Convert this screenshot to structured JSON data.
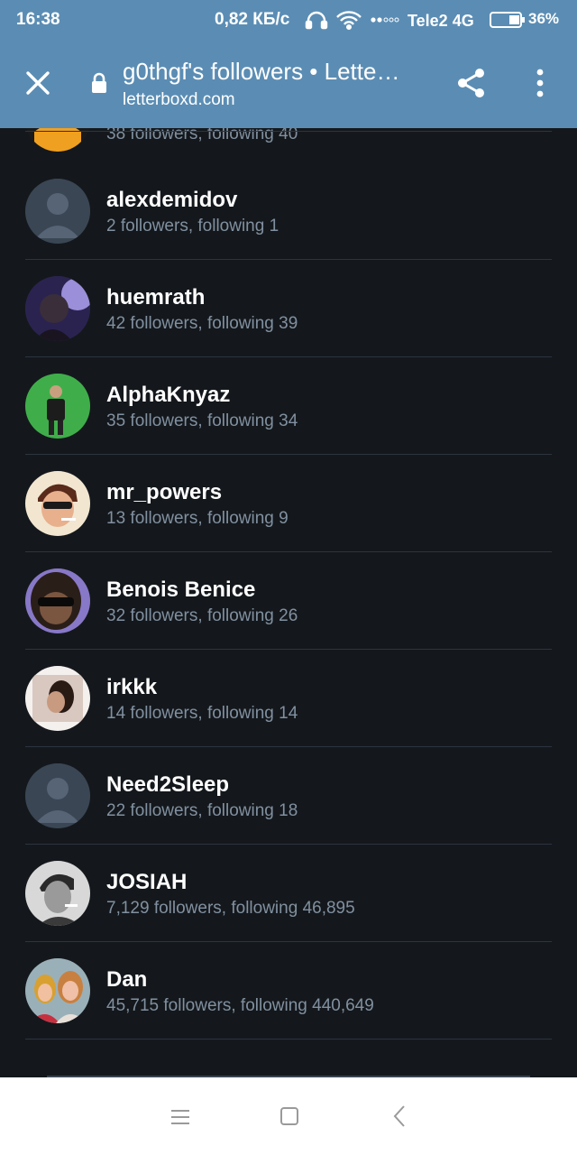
{
  "status_bar": {
    "time": "16:38",
    "speed": "0,82 КБ/с",
    "carrier": "Tele2 4G",
    "battery": "36%"
  },
  "browser": {
    "title": "g0thgf's followers • Lette…",
    "url": "letterboxd.com"
  },
  "partial_row": {
    "stats": "38 followers, following 40"
  },
  "followers": [
    {
      "name": "alexdemidov",
      "stats": "2 followers, following 1"
    },
    {
      "name": "huemrath",
      "stats": "42 followers, following 39"
    },
    {
      "name": "AlphaKnyaz",
      "stats": "35 followers, following 34"
    },
    {
      "name": "mr_powers",
      "stats": "13 followers, following 9"
    },
    {
      "name": "Benois Benice",
      "stats": "32 followers, following 26"
    },
    {
      "name": "irkkk",
      "stats": "14 followers, following 14"
    },
    {
      "name": "Need2Sleep",
      "stats": "22 followers, following 18"
    },
    {
      "name": "JOSIAH",
      "stats": "7,129 followers, following 46,895"
    },
    {
      "name": "Dan",
      "stats": "45,715 followers, following 440,649"
    }
  ],
  "colors": {
    "app_bar": "#5b8db4",
    "background": "#14181c",
    "secondary_text": "#8190a0"
  }
}
